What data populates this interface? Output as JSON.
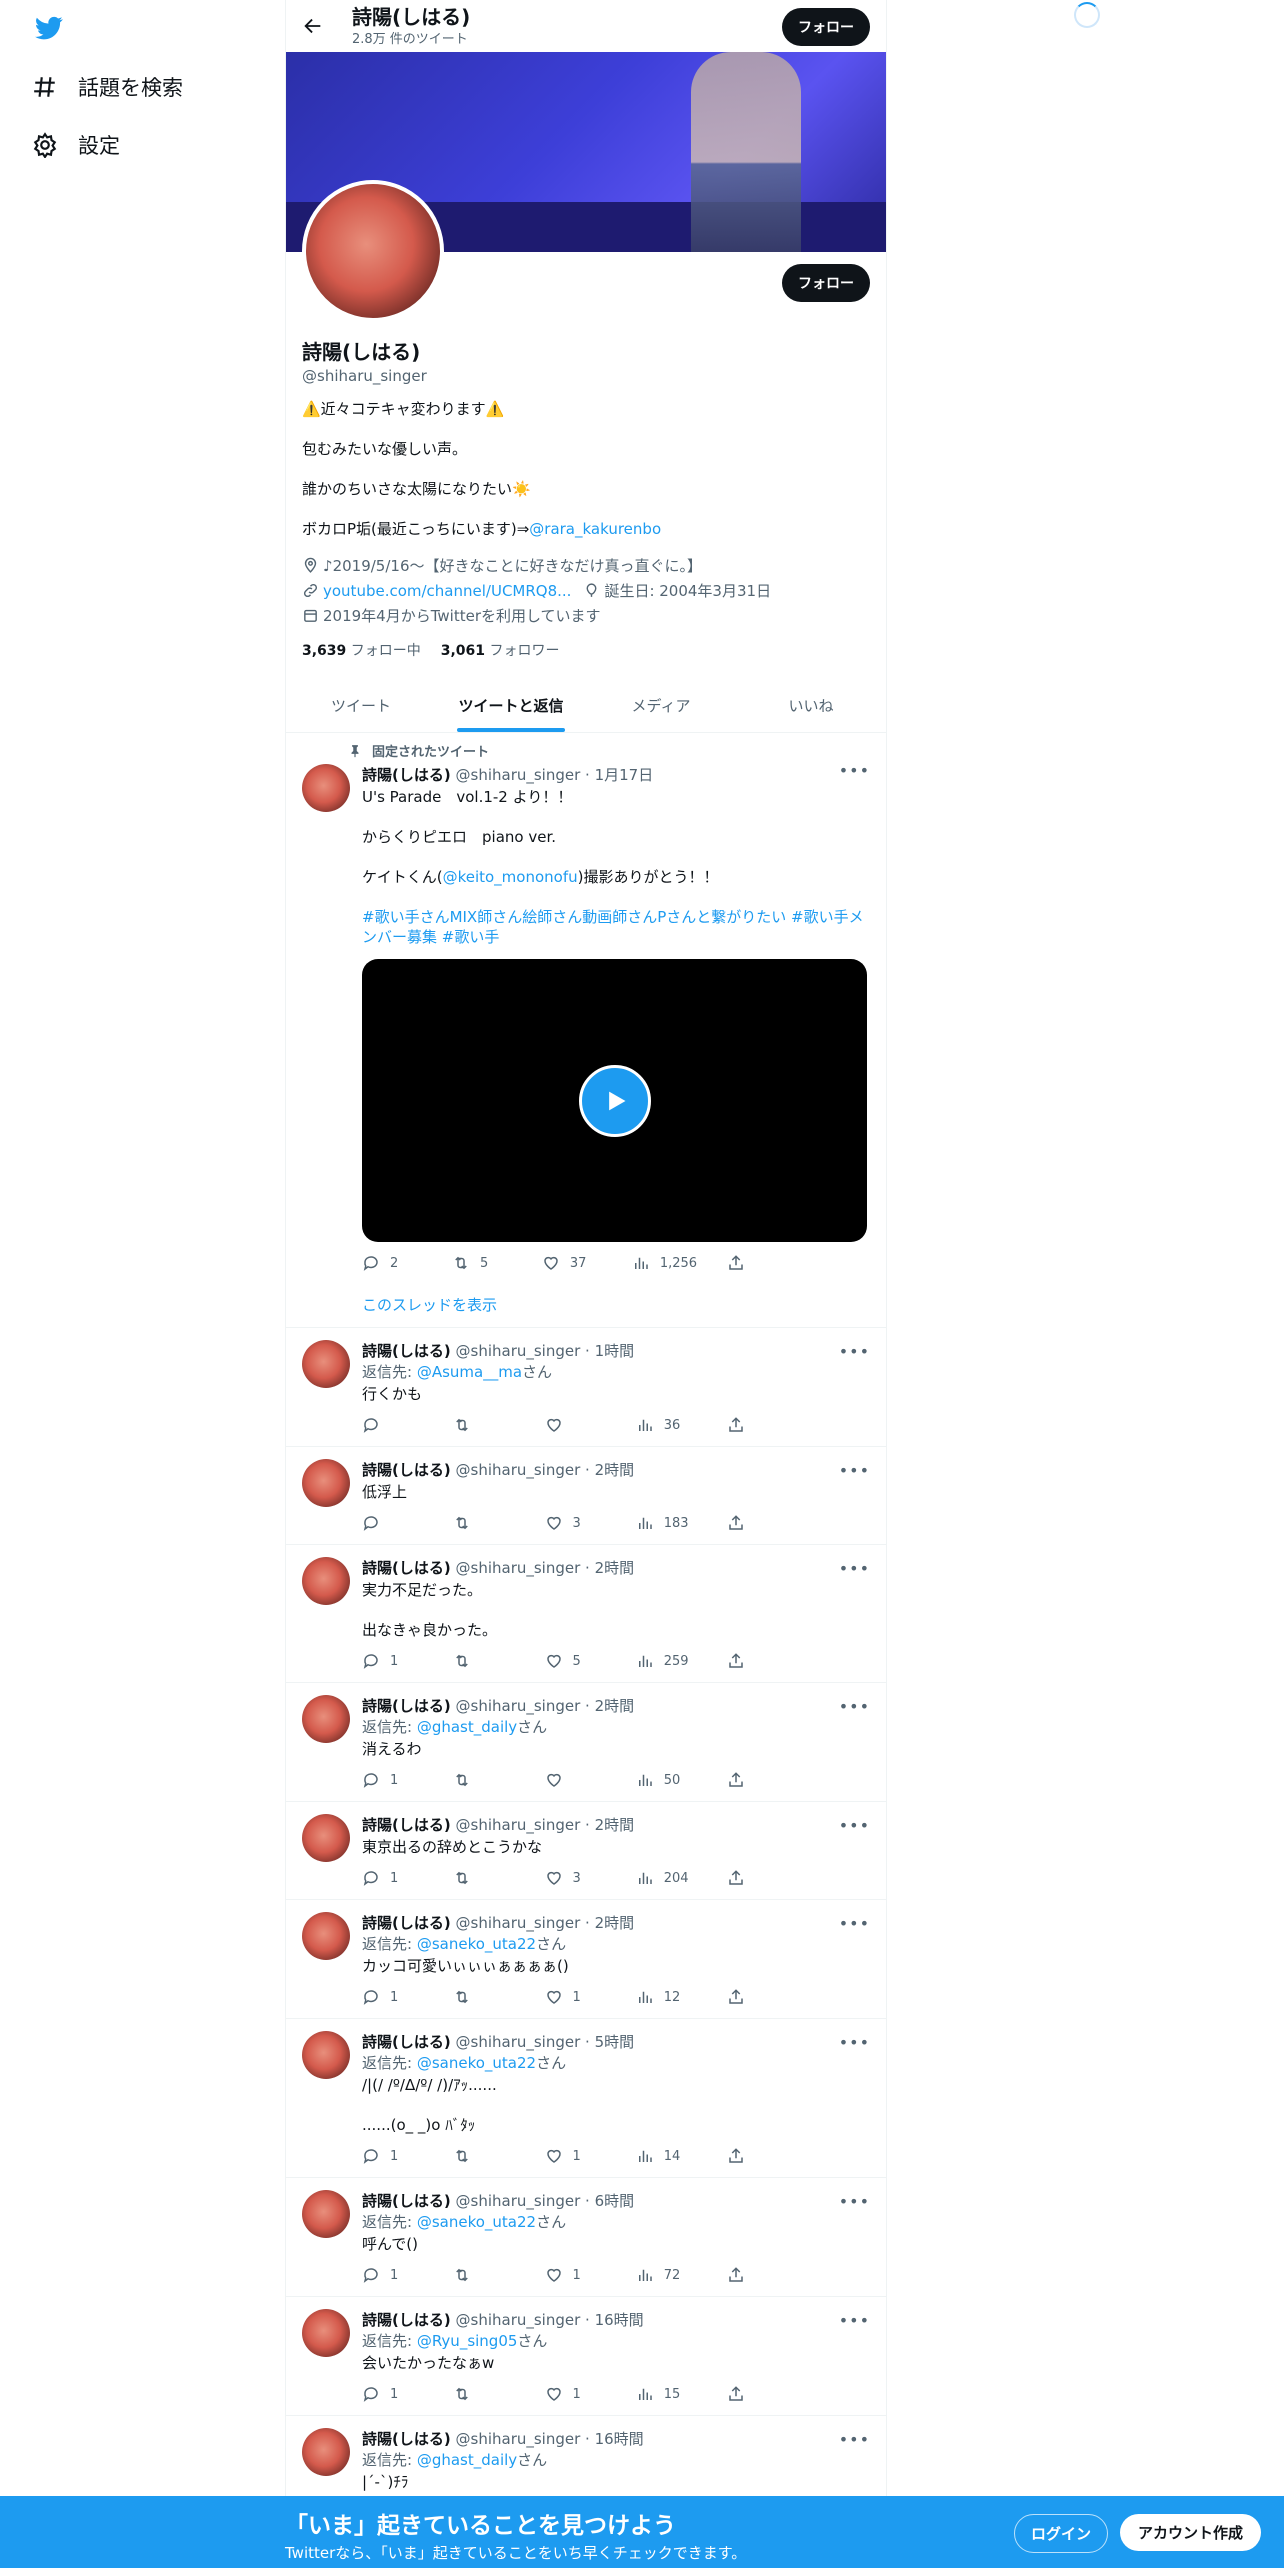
{
  "nav": {
    "explore": "話題を検索",
    "settings": "設定"
  },
  "header": {
    "name": "詩陽(しはる)",
    "tweet_count": "2.8万 件のツイート",
    "follow": "フォロー"
  },
  "profile": {
    "follow": "フォロー",
    "name": "詩陽(しはる)",
    "handle": "@shiharu_singer",
    "bio_1": "⚠️近々コテキャ変わります⚠️",
    "bio_2": "包むみたいな優しい声。",
    "bio_3": "誰かのちいさな太陽になりたい☀️",
    "bio_4_text": "ボカロP垢(最近こっちにいます)⇒",
    "bio_4_link": "@rara_kakurenbo",
    "location": "♪2019/5/16〜【好きなことに好きなだけ真っ直ぐに。】",
    "url": "youtube.com/channel/UCMRQ8...",
    "birthday": "誕生日: 2004年3月31日",
    "joined": "2019年4月からTwitterを利用しています",
    "following_count": "3,639",
    "following_label": "フォロー中",
    "followers_count": "3,061",
    "followers_label": "フォロワー"
  },
  "tabs": [
    "ツイート",
    "ツイートと返信",
    "メディア",
    "いいね"
  ],
  "pinned": {
    "label": "固定されたツイート",
    "name": "詩陽(しはる)",
    "handle": "@shiharu_singer",
    "time": "1月17日",
    "line1": "U's Parade　vol.1-2 より！！",
    "line2": "からくりピエロ　piano ver.",
    "line3_a": "ケイトくん(",
    "line3_link": "@keito_mononofu",
    "line3_b": ")撮影ありがとう！！",
    "hashtags": "#歌い手さんMIX師さん絵師さん動画師さんPさんと繋がりたい #歌い手メンバー募集 #歌い手",
    "replies": "2",
    "retweets": "5",
    "likes": "37",
    "views": "1,256",
    "thread_link": "このスレッドを表示"
  },
  "tweets": [
    {
      "name": "詩陽(しはる)",
      "handle": "@shiharu_singer",
      "time": "1時間",
      "reply_prefix": "返信先: ",
      "reply_to": "@Asuma__ma",
      "reply_suffix": "さん",
      "text": "行くかも",
      "replies": "",
      "retweets": "",
      "likes": "",
      "views": "36"
    },
    {
      "name": "詩陽(しはる)",
      "handle": "@shiharu_singer",
      "time": "2時間",
      "text": "低浮上",
      "replies": "",
      "retweets": "",
      "likes": "3",
      "views": "183"
    },
    {
      "name": "詩陽(しはる)",
      "handle": "@shiharu_singer",
      "time": "2時間",
      "text": "実力不足だった。",
      "text2": "出なきゃ良かった。",
      "replies": "1",
      "retweets": "",
      "likes": "5",
      "views": "259"
    },
    {
      "name": "詩陽(しはる)",
      "handle": "@shiharu_singer",
      "time": "2時間",
      "reply_prefix": "返信先: ",
      "reply_to": "@ghast_daily",
      "reply_suffix": "さん",
      "text": "消えるわ",
      "replies": "1",
      "retweets": "",
      "likes": "",
      "views": "50"
    },
    {
      "name": "詩陽(しはる)",
      "handle": "@shiharu_singer",
      "time": "2時間",
      "text": "東京出るの辞めとこうかな",
      "replies": "1",
      "retweets": "",
      "likes": "3",
      "views": "204"
    },
    {
      "name": "詩陽(しはる)",
      "handle": "@shiharu_singer",
      "time": "2時間",
      "reply_prefix": "返信先: ",
      "reply_to": "@saneko_uta22",
      "reply_suffix": "さん",
      "text": "カッコ可愛いぃぃぃぁぁぁぁ()",
      "replies": "1",
      "retweets": "",
      "likes": "1",
      "views": "12"
    },
    {
      "name": "詩陽(しはる)",
      "handle": "@shiharu_singer",
      "time": "5時間",
      "reply_prefix": "返信先: ",
      "reply_to": "@saneko_uta22",
      "reply_suffix": "さん",
      "text": "/|(/ /º/Δ/º/ /)/ｱｯ......",
      "text2": "......(o_ _)o ﾊﾞﾀｯ",
      "replies": "1",
      "retweets": "",
      "likes": "1",
      "views": "14"
    },
    {
      "name": "詩陽(しはる)",
      "handle": "@shiharu_singer",
      "time": "6時間",
      "reply_prefix": "返信先: ",
      "reply_to": "@saneko_uta22",
      "reply_suffix": "さん",
      "text": "呼んで()",
      "replies": "1",
      "retweets": "",
      "likes": "1",
      "views": "72"
    },
    {
      "name": "詩陽(しはる)",
      "handle": "@shiharu_singer",
      "time": "16時間",
      "reply_prefix": "返信先: ",
      "reply_to": "@Ryu_sing05",
      "reply_suffix": "さん",
      "text": "会いたかったなぁw",
      "replies": "1",
      "retweets": "",
      "likes": "1",
      "views": "15"
    },
    {
      "name": "詩陽(しはる)",
      "handle": "@shiharu_singer",
      "time": "16時間",
      "reply_prefix": "返信先: ",
      "reply_to": "@ghast_daily",
      "reply_suffix": "さん",
      "text": "|´-`)ﾁﾗ"
    }
  ],
  "bottom": {
    "headline": "「いま」起きていることを見つけよう",
    "subtext": "Twitterなら、「いま」起きていることをいち早くチェックできます。",
    "login": "ログイン",
    "signup": "アカウント作成"
  }
}
